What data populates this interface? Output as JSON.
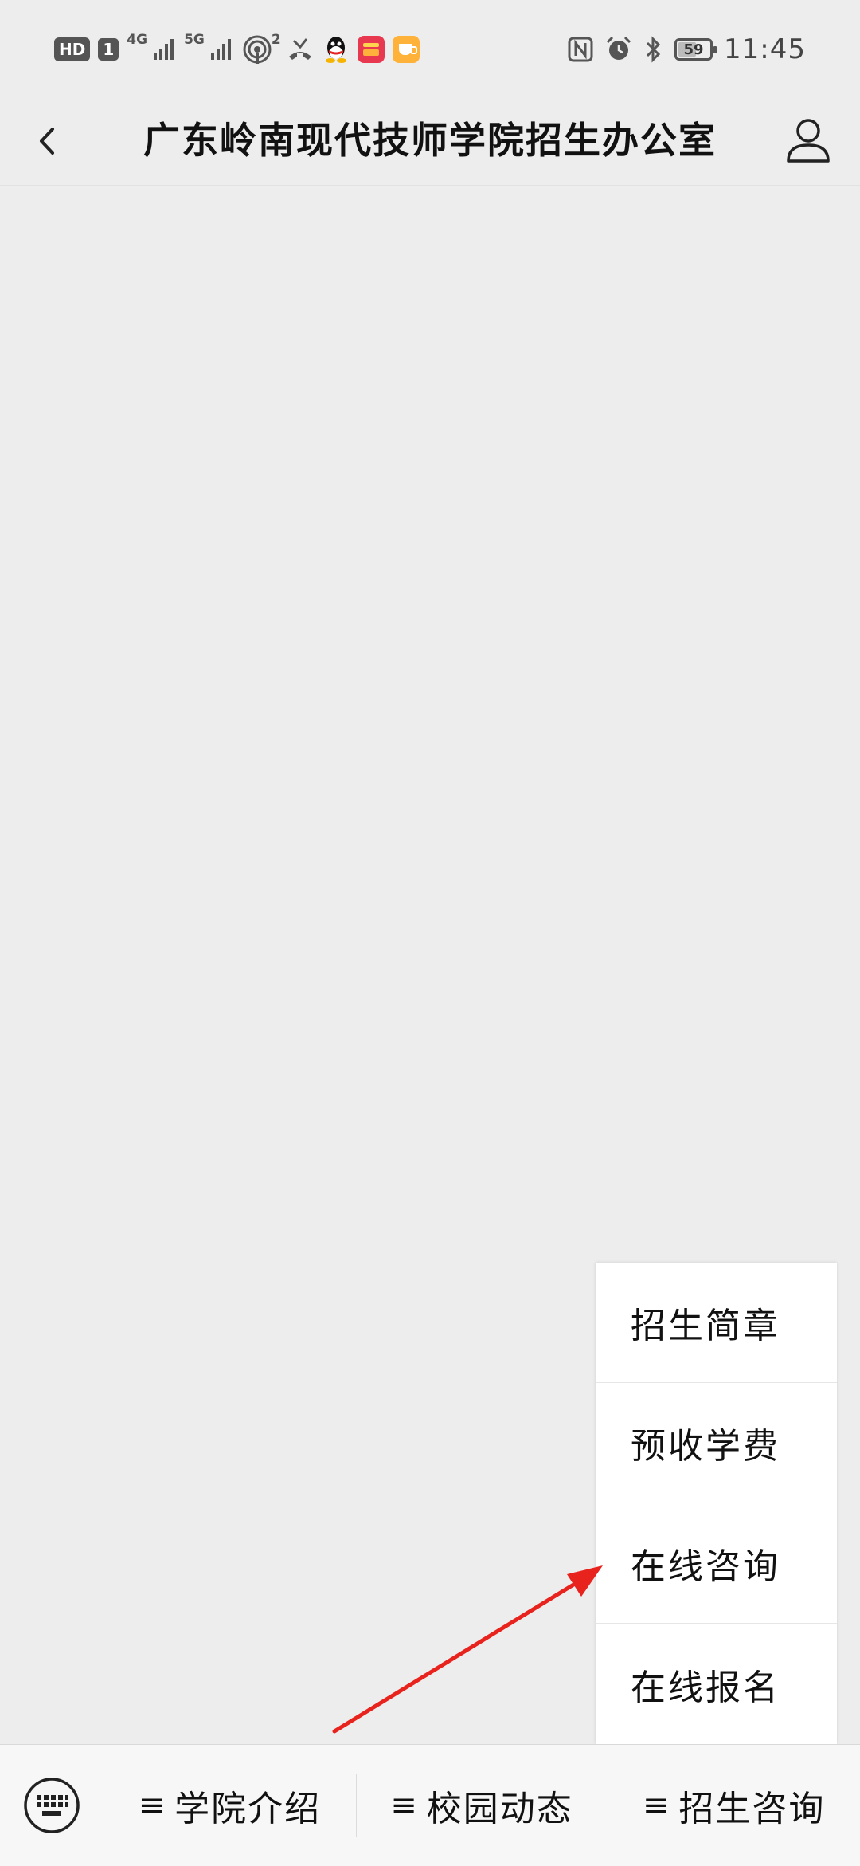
{
  "status_bar": {
    "hd_label": "HD",
    "sim_label": "1",
    "net_4g": "4G",
    "net_5g": "5G",
    "hotspot_count": "2",
    "battery_level": "59",
    "battery_fraction": 0.59,
    "time": "11:45",
    "icons": [
      "signal-icon",
      "hotspot-icon",
      "missed-call-icon",
      "qq-icon",
      "app-red-icon",
      "app-yellow-icon",
      "nfc-icon",
      "alarm-icon",
      "bluetooth-icon",
      "battery-icon"
    ]
  },
  "header": {
    "title": "广东岭南现代技师学院招生办公室"
  },
  "popup_menu": {
    "items": [
      {
        "label": "招生简章"
      },
      {
        "label": "预收学费"
      },
      {
        "label": "在线咨询"
      },
      {
        "label": "在线报名"
      }
    ]
  },
  "bottom_menu": {
    "menu_glyph": "≡",
    "items": [
      {
        "label": "学院介绍"
      },
      {
        "label": "校园动态"
      },
      {
        "label": "招生咨询"
      }
    ]
  },
  "colors": {
    "background": "#ededed",
    "arrow": "#e8231d",
    "bottom_bar": "#f7f7f7"
  }
}
